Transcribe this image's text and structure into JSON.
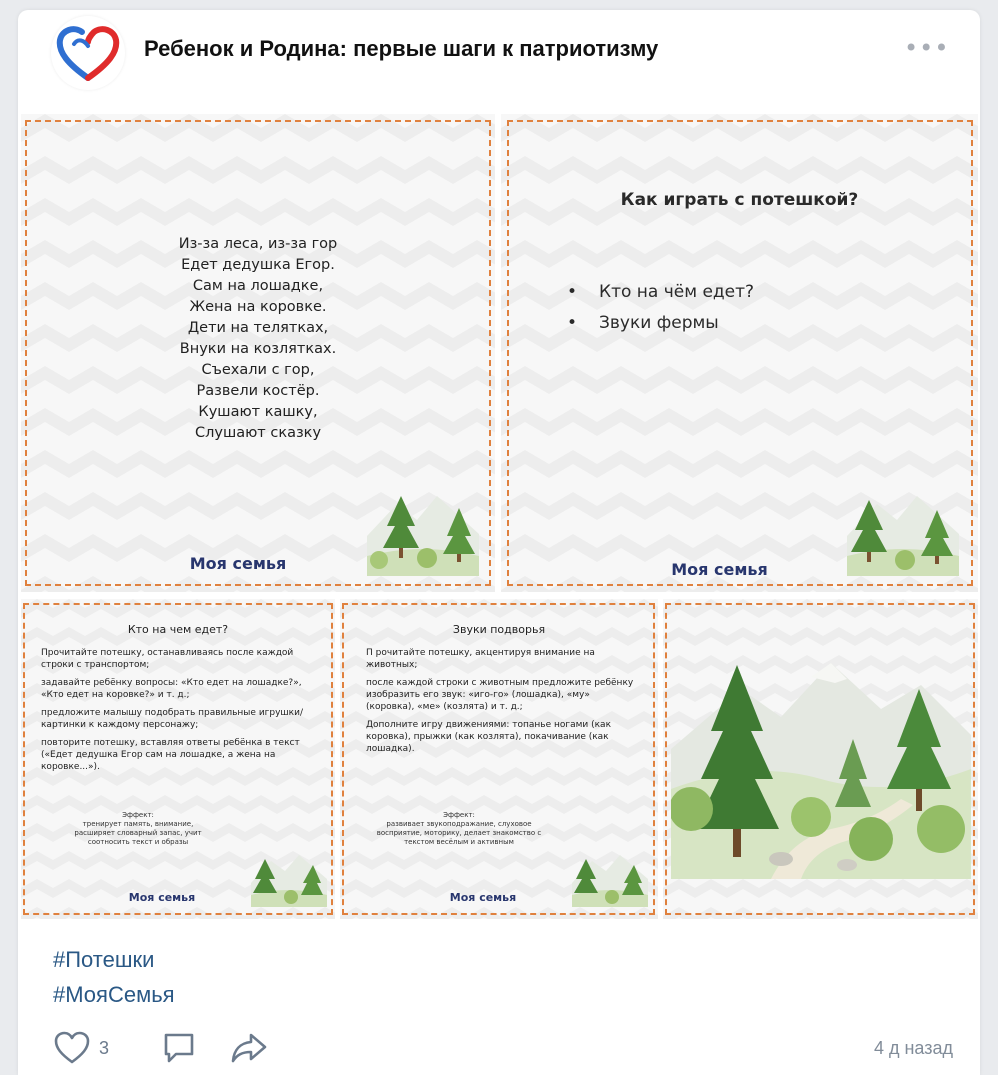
{
  "post": {
    "title": "Ребенок и Родина: первые шаги к патриотизму",
    "more_label": "•••",
    "hashtags": [
      "#Потешки",
      "#МояСемья"
    ],
    "likes_count": "3",
    "time": "4 д назад"
  },
  "gallery": {
    "card1": {
      "poem": [
        "Из-за леса, из-за гор",
        "Едет дедушка Егор.",
        "Сам на лошадке,",
        "Жена на коровке.",
        "Дети на телятках,",
        "Внуки на козлятках.",
        "Съехали с гор,",
        "Развели костёр.",
        "Кушают кашку,",
        "Слушают сказку"
      ],
      "footer": "Моя семья"
    },
    "card2": {
      "title": "Как играть с потешкой?",
      "bullets": [
        "Кто на чём едет?",
        "Звуки фермы"
      ],
      "footer": "Моя семья"
    },
    "card3": {
      "title": "Кто на чем едет?",
      "paragraphs": [
        "Прочитайте потешку, останавливаясь после каждой строки с транспортом;",
        "задавайте ребёнку вопросы: «Кто едет на лошадке?», «Кто едет на коровке?» и т. д.;",
        "предложите малышу подобрать правильные игрушки/картинки к каждому персонажу;",
        "повторите потешку, вставляя ответы ребёнка в текст («Едет дедушка Егор сам на лошадке, а жена на коровке...»)."
      ],
      "effect_title": "Эффект:",
      "effect_lines": [
        "тренирует память, внимание,",
        "расширяет словарный запас, учит",
        "соотносить текст и образы"
      ],
      "footer": "Моя семья"
    },
    "card4": {
      "title": "Звуки подворья",
      "paragraphs": [
        "П рочитайте потешку, акцентируя внимание на животных;",
        "после каждой строки с животным предложите ребёнку изобразить его звук: «иго-го» (лошадка), «му» (коровка), «ме» (козлята) и т. д.;",
        "Дополните игру движениями: топанье ногами (как коровка), прыжки (как козлята), покачивание (как лошадка)."
      ],
      "effect_title": "Эффект:",
      "effect_lines": [
        "развивает звукоподражание, слуховое",
        "восприятие, моторику, делает знакомство с",
        "текстом весёлым и активным"
      ],
      "footer": "Моя семья"
    }
  },
  "colors": {
    "accent": "#2a5885",
    "frame": "#e0813e",
    "footer_text": "#28366e"
  },
  "icons": {
    "like": "heart-icon",
    "comment": "comment-icon",
    "share": "share-icon",
    "logo": "heart-logo-icon"
  }
}
